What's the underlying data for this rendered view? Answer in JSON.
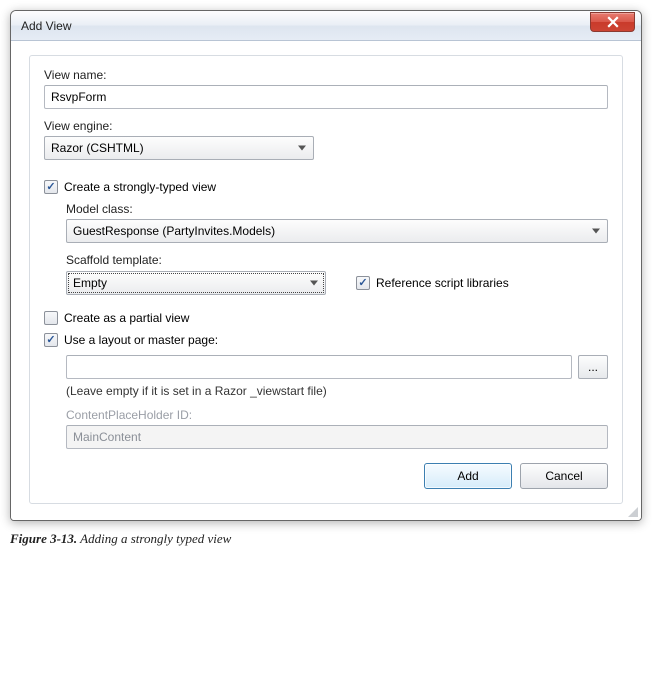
{
  "window": {
    "title": "Add View"
  },
  "viewName": {
    "label": "View name:",
    "value": "RsvpForm"
  },
  "viewEngine": {
    "label": "View engine:",
    "value": "Razor (CSHTML)"
  },
  "stronglyTyped": {
    "checkbox_label": "Create a strongly-typed view",
    "checked": true,
    "modelClass": {
      "label": "Model class:",
      "value": "GuestResponse (PartyInvites.Models)"
    },
    "scaffold": {
      "label": "Scaffold template:",
      "value": "Empty"
    },
    "referenceScripts": {
      "label": "Reference script libraries",
      "checked": true
    }
  },
  "partialView": {
    "label": "Create as a partial view",
    "checked": false
  },
  "layout": {
    "checkbox_label": "Use a layout or master page:",
    "checked": true,
    "path_value": "",
    "browse_label": "...",
    "hint": "(Leave empty if it is set in a Razor _viewstart file)",
    "placeholder_label": "ContentPlaceHolder ID:",
    "placeholder_value": "MainContent"
  },
  "buttons": {
    "add": "Add",
    "cancel": "Cancel"
  },
  "caption": {
    "prefix": "Figure 3-13.",
    "text": " Adding a strongly typed view"
  }
}
